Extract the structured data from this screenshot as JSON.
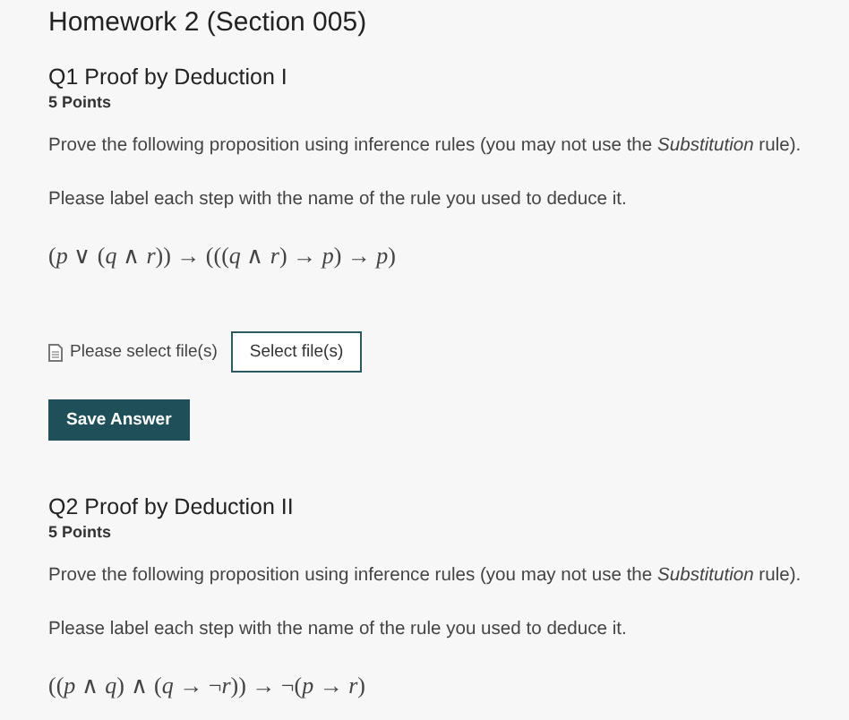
{
  "title": "Homework 2 (Section 005)",
  "questions": [
    {
      "heading": "Q1 Proof by Deduction I",
      "points": "5 Points",
      "paragraphs": [
        "Prove the following proposition using inference rules (you may not use the *Substitution* rule).",
        "Please label each step with the name of the rule you used to deduce it."
      ],
      "formula": "(*p* ∨ (*q* ∧ *r*)) → (((*q* ∧ *r*) → *p*) → *p*)",
      "upload": {
        "status": "Please select file(s)",
        "button": "Select file(s)"
      },
      "save_button": "Save Answer"
    },
    {
      "heading": "Q2 Proof by Deduction II",
      "points": "5 Points",
      "paragraphs": [
        "Prove the following proposition using inference rules (you may not use the *Substitution* rule).",
        "Please label each step with the name of the rule you used to deduce it."
      ],
      "formula": "((*p* ∧ *q*) ∧ (*q* → ¬*r*)) → ¬(*p* → *r*)"
    }
  ]
}
